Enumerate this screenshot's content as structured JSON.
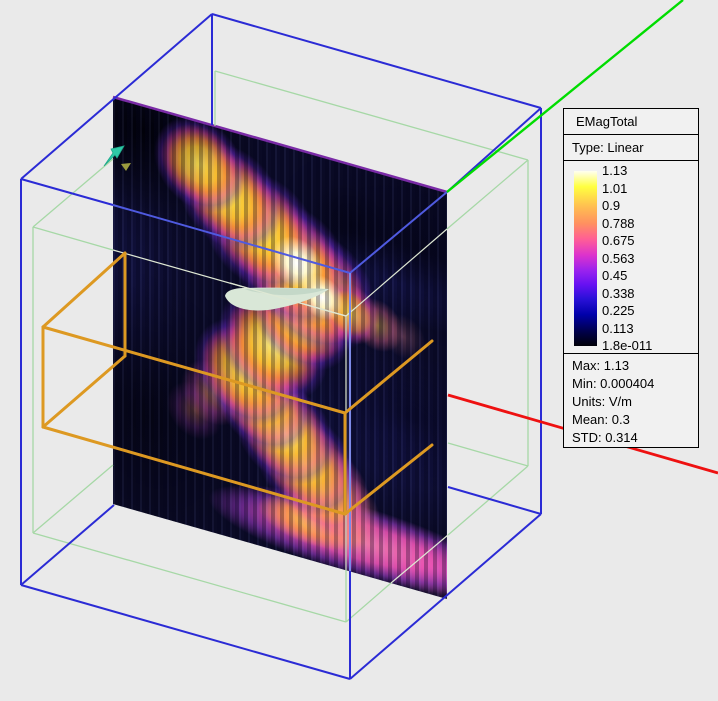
{
  "legend": {
    "title": "EMagTotal",
    "type_label": "Type: Linear",
    "scale_values": [
      "1.13",
      "1.01",
      "0.9",
      "0.788",
      "0.675",
      "0.563",
      "0.45",
      "0.338",
      "0.225",
      "0.113",
      "1.8e-011"
    ],
    "stats": [
      "Max: 1.13",
      "Min: 0.000404",
      "Units: V/m",
      "Mean: 0.3",
      "STD: 0.314"
    ]
  },
  "scene": {
    "colors": {
      "outer_box": "#2b2bd5",
      "inner_box": "#a6d8a6",
      "waveguide_box": "#dd9922",
      "axis_green": "#00dd00",
      "axis_red": "#ee1111",
      "plane_border": "#7a2ba6",
      "arrow_teal": "#2fc9a7",
      "marker_olive": "#9b9b3f",
      "airfoil_fill": "#d9e7d7",
      "airfoil_shade": "#c4d8c8",
      "background": "#eaeaea",
      "plane_base": "#0b0b28"
    }
  }
}
